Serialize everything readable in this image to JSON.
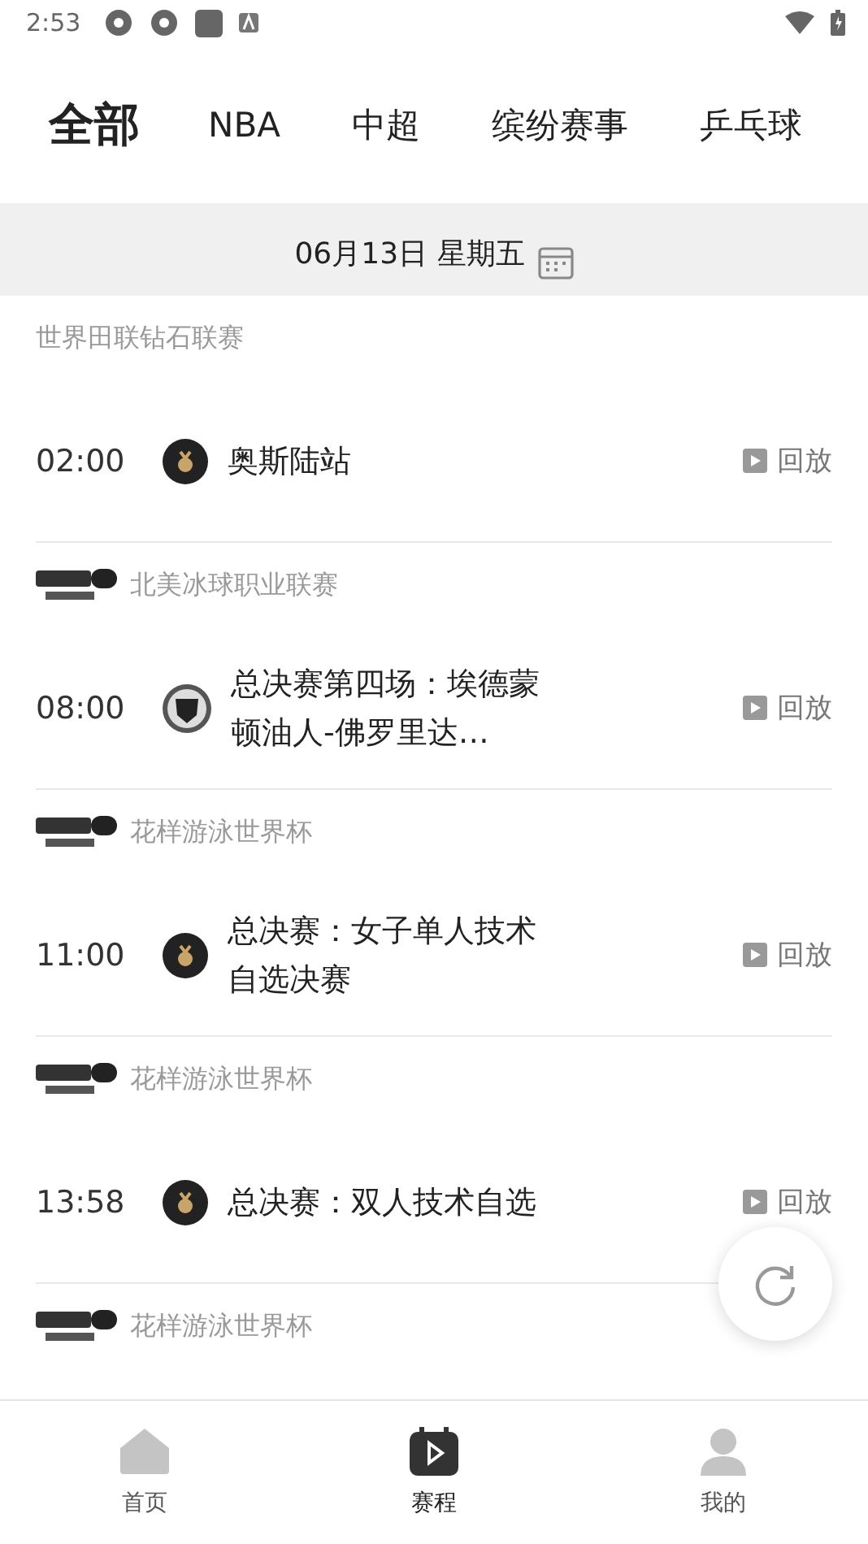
{
  "status_bar": {
    "time": "2:53"
  },
  "tabs": [
    {
      "label": "全部",
      "selected": true
    },
    {
      "label": "NBA",
      "selected": false
    },
    {
      "label": "中超",
      "selected": false
    },
    {
      "label": "缤纷赛事",
      "selected": false
    },
    {
      "label": "乒乓球",
      "selected": false
    }
  ],
  "date_bar": {
    "date": "06月13日",
    "weekday": "星期五"
  },
  "groups": [
    {
      "league": "世界田联钻石联赛",
      "channel_logo": false,
      "matches": [
        {
          "time": "02:00",
          "kind": "medal",
          "title": "奥斯陆站",
          "action": "回放"
        }
      ]
    },
    {
      "league": "北美冰球职业联赛",
      "channel_logo": true,
      "matches": [
        {
          "time": "08:00",
          "kind": "shield",
          "title": "总决赛第四场：埃德蒙顿油人-佛罗里达…",
          "action": "回放"
        }
      ]
    },
    {
      "league": "花样游泳世界杯",
      "channel_logo": true,
      "matches": [
        {
          "time": "11:00",
          "kind": "medal",
          "title": "总决赛：女子单人技术自选决赛",
          "action": "回放"
        }
      ]
    },
    {
      "league": "花样游泳世界杯",
      "channel_logo": true,
      "matches": [
        {
          "time": "13:58",
          "kind": "medal",
          "title": "总决赛：双人技术自选",
          "action": "回放"
        }
      ]
    },
    {
      "league": "花样游泳世界杯",
      "channel_logo": true
    }
  ],
  "bottom_nav": [
    {
      "label": "首页",
      "kind": "home",
      "selected": false
    },
    {
      "label": "赛程",
      "kind": "schedule",
      "selected": true
    },
    {
      "label": "我的",
      "kind": "person",
      "selected": false
    }
  ]
}
